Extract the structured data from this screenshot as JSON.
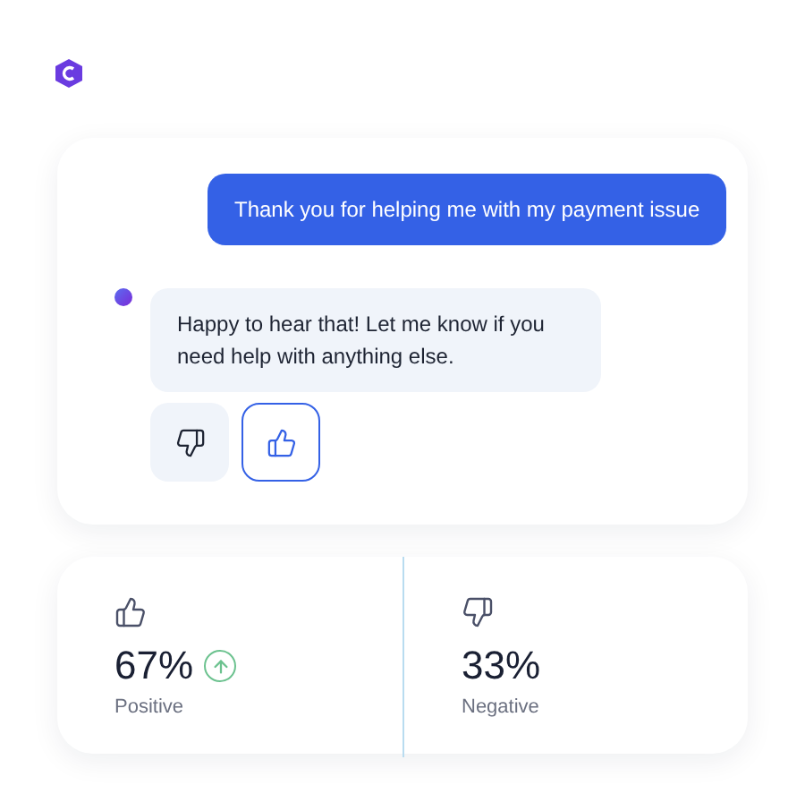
{
  "chat": {
    "messages": [
      {
        "kind": "user",
        "text": "Thank you for helping me with my payment issue"
      },
      {
        "kind": "bot",
        "text": "Happy to hear that! Let me know if you need help with anything else."
      }
    ],
    "feedback": [
      {
        "kind": "down",
        "selected": false
      },
      {
        "kind": "up",
        "selected": true
      }
    ]
  },
  "stats": [
    {
      "kind": "up",
      "value": "67%",
      "label": "Positive",
      "trend_up": true
    },
    {
      "kind": "down",
      "value": "33%",
      "label": "Negative"
    }
  ]
}
